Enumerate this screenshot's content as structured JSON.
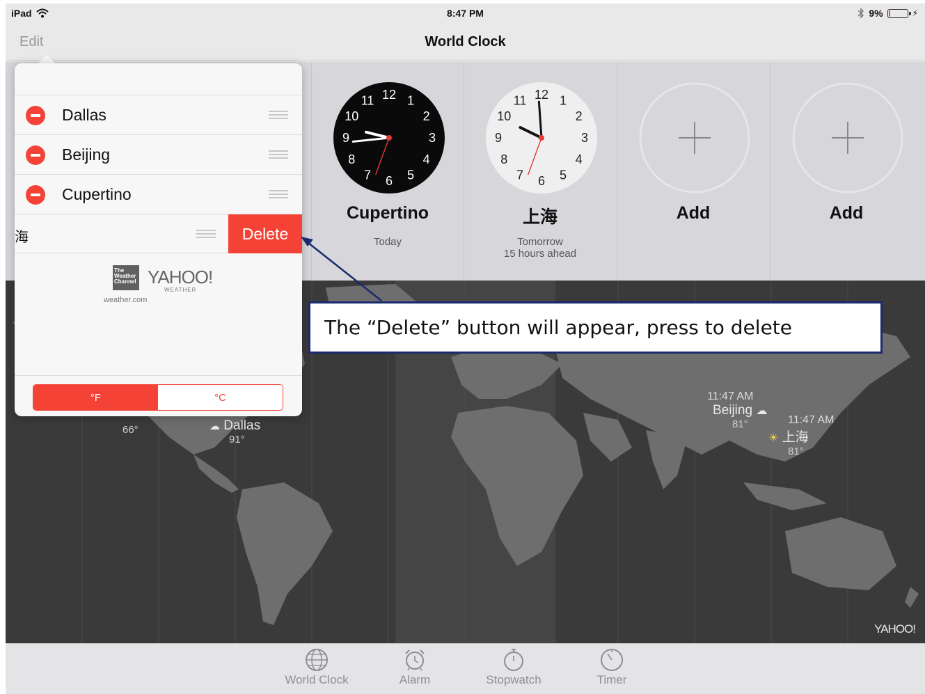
{
  "status_bar": {
    "device": "iPad",
    "time": "8:47 PM",
    "battery": "9%",
    "battery_level": 0.09
  },
  "navbar": {
    "edit_label": "Edit",
    "title": "World Clock"
  },
  "clocks": [
    {
      "name": "Cupertino",
      "sub1": "Today",
      "sub2": "",
      "style": "dark"
    },
    {
      "name": "上海",
      "sub1": "Tomorrow",
      "sub2": "15 hours ahead",
      "style": "light"
    },
    {
      "name": "Add",
      "sub1": "",
      "sub2": "",
      "style": "add"
    },
    {
      "name": "Add",
      "sub1": "",
      "sub2": "",
      "style": "add"
    }
  ],
  "clock_numbers": [
    "12",
    "1",
    "2",
    "3",
    "4",
    "5",
    "6",
    "7",
    "8",
    "9",
    "10",
    "11"
  ],
  "popover": {
    "rows": [
      {
        "label": "Dallas"
      },
      {
        "label": "Beijing"
      },
      {
        "label": "Cupertino"
      }
    ],
    "swiped_row_stub": "海",
    "delete_label": "Delete",
    "logo_twc": [
      "The",
      "Weather",
      "Channel"
    ],
    "logo_yahoo": "YAHOO!",
    "logo_yahoo_sub": "WEATHER",
    "logo_weathercom": "weather.com",
    "unit_f": "°F",
    "unit_c": "°C"
  },
  "map": {
    "cities": [
      {
        "name": "Beijing",
        "time": "11:47 AM",
        "temp": "81°"
      },
      {
        "name": "上海",
        "time": "11:47 AM",
        "temp": "81°"
      },
      {
        "name": "Dallas",
        "time": "",
        "temp": "91°"
      },
      {
        "name": "Cupertino",
        "time": "",
        "temp": "66°"
      }
    ],
    "watermark": "YAHOO!"
  },
  "tabs": [
    {
      "label": "World Clock",
      "icon": "globe-icon"
    },
    {
      "label": "Alarm",
      "icon": "alarm-clock-icon"
    },
    {
      "label": "Stopwatch",
      "icon": "stopwatch-icon"
    },
    {
      "label": "Timer",
      "icon": "timer-icon"
    }
  ],
  "callout": {
    "text": "The “Delete” button will appear, press to delete"
  }
}
